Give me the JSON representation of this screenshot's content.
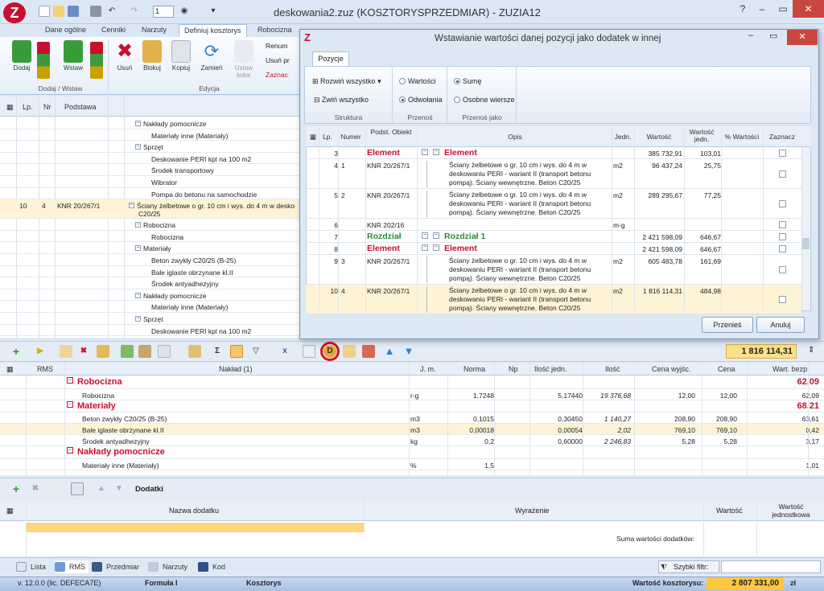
{
  "window": {
    "title": "deskowania2.zuz (KOSZTORYSPRZEDMIAR) - ZUZIA12",
    "logo": "Z",
    "quick_combo": "1"
  },
  "ribbon_tabs": [
    "Dane ogólne",
    "Cenniki",
    "Narzuty",
    "Definiuj kosztorys",
    "Robocizna"
  ],
  "ribbon": {
    "buttons": [
      "Dodaj",
      "Wstaw",
      "Usuń",
      "Blokuj",
      "Kopiuj",
      "Zamień",
      "Ustaw kolor"
    ],
    "small": [
      "Renum",
      "Usuń pr",
      "Zaznac"
    ],
    "groups": [
      "Dodaj / Wstaw",
      "Edycja"
    ]
  },
  "left_grid": {
    "headers": [
      "Lp.",
      "Nr",
      "Podstawa"
    ],
    "rows": [
      {
        "indent": 1,
        "box": "−",
        "text": "Nakłady pomocnicze"
      },
      {
        "indent": 2,
        "box": "",
        "text": "Materiały inne (Materiały)"
      },
      {
        "indent": 1,
        "box": "−",
        "text": "Sprzęt"
      },
      {
        "indent": 2,
        "box": "",
        "text": "Deskowanie PERI kpl na 100 m2"
      },
      {
        "indent": 2,
        "box": "",
        "text": "Środek transportowy"
      },
      {
        "indent": 2,
        "box": "",
        "text": "Wibrator"
      },
      {
        "indent": 2,
        "box": "",
        "text": "Pompa do betonu na samochodzie"
      },
      {
        "lp": "10",
        "nr": "4",
        "podstawa": "KNR 20/267/1",
        "indent": 0,
        "box": "−",
        "text": "Ściany żelbetowe o gr. 10 cm i wys. do 4 m w desko",
        "text2": "C20/25",
        "selected": true
      },
      {
        "indent": 1,
        "box": "−",
        "text": "Robocizna"
      },
      {
        "indent": 2,
        "box": "",
        "text": "Robocizna"
      },
      {
        "indent": 1,
        "box": "−",
        "text": "Materiały"
      },
      {
        "indent": 2,
        "box": "",
        "text": "Beton zwykły C20/25 (B-25)"
      },
      {
        "indent": 2,
        "box": "",
        "text": "Bale iglaste obrzynane kl.II"
      },
      {
        "indent": 2,
        "box": "",
        "text": "Środek antyadhezyjny"
      },
      {
        "indent": 1,
        "box": "−",
        "text": "Nakłady pomocnicze"
      },
      {
        "indent": 2,
        "box": "",
        "text": "Materiały inne (Materiały)"
      },
      {
        "indent": 1,
        "box": "−",
        "text": "Sprzęt"
      },
      {
        "indent": 2,
        "box": "",
        "text": "Deskowanie PERI kpl na 100 m2"
      }
    ]
  },
  "mid_toolbar": {
    "total": "1 816 114,31",
    "circled_icon": "dodatek-d-icon"
  },
  "rms": {
    "headers": [
      "RMS",
      "Nakład (1)",
      "J. m.",
      "Norma",
      "Np",
      "Ilość jedn.",
      "Ilość",
      "Cena wyjśc.",
      "Cena",
      "Wart. bezp."
    ],
    "rows": [
      {
        "section": true,
        "name": "Robocizna",
        "wart": "62,09"
      },
      {
        "name": "Robocizna",
        "jm": "r-g",
        "norma": "1,7248",
        "np": "",
        "ilj": "5,17440",
        "il": "19 376,68",
        "cw": "12,00",
        "cena": "12,00",
        "wart": "62,09"
      },
      {
        "section": true,
        "name": "Materiały",
        "wart": "68,21"
      },
      {
        "name": "Beton zwykły C20/25 (B-25)",
        "jm": "m3",
        "norma": "0,1015",
        "np": "",
        "ilj": "0,30450",
        "il": "1 140,27",
        "cw": "208,90",
        "cena": "208,90",
        "wart": "63,61"
      },
      {
        "name": "Bale iglaste obrzynane kl.II",
        "jm": "m3",
        "norma": "0,00018",
        "np": "",
        "ilj": "0,00054",
        "il": "2,02",
        "cw": "769,10",
        "cena": "769,10",
        "wart": "0,42",
        "selected": true
      },
      {
        "name": "Środek antyadhezyjny",
        "jm": "kg",
        "norma": "0,2",
        "np": "",
        "ilj": "0,60000",
        "il": "2 246,83",
        "cw": "5,28",
        "cena": "5,28",
        "wart": "3,17"
      },
      {
        "section": true,
        "name": "Nakłady pomocnicze",
        "wart": ""
      },
      {
        "name": "Materiały inne (Materiały)",
        "jm": "%",
        "norma": "1,5",
        "np": "",
        "ilj": "",
        "il": "",
        "cw": "",
        "cena": "",
        "wart": "1,01"
      }
    ]
  },
  "dodatki": {
    "title": "Dodatki",
    "headers": [
      "Nazwa dodatku",
      "Wyrażenie",
      "Wartość",
      "Wartość jednostkowa"
    ],
    "sum_label": "Suma wartości dodatków:"
  },
  "bottom_tabs": [
    "Lista",
    "RMS",
    "Przedmiar",
    "Narzuty",
    "Kod"
  ],
  "filter_label": "Szybki filtr:",
  "status": {
    "version": "v. 12.0.0 (lic. DEFECA7E)",
    "formula": "Formuła I",
    "kosztorys": "Kosztorys",
    "value_label": "Wartość kosztorysu:",
    "value": "2 807 331,00",
    "currency": "zł"
  },
  "dialog": {
    "title": "Wstawianie wartości danej pozycji jako dodatek w innej",
    "tab": "Pozycje",
    "struktura": {
      "label": "Struktura",
      "expand": "Rozwiń wszystko",
      "collapse": "Zwiń wszystko"
    },
    "przenos": {
      "label": "Przenoś",
      "opt1": "Wartości",
      "opt2": "Odwołania"
    },
    "przenos_jako": {
      "label": "Przenoś jako",
      "opt1": "Sumę",
      "opt2": "Osobne wiersze"
    },
    "headers": [
      "Lp.",
      "Numer",
      "Podst. Obiekt",
      "Opis",
      "Jedn.",
      "Wartość",
      "Wartość jedn.",
      "% Wartości",
      "Zaznacz"
    ],
    "rows": [
      {
        "lp": "3",
        "num": "",
        "podst": "Element",
        "opis": "Element",
        "jedn": "",
        "wart": "385 732,91",
        "wj": "103,01",
        "kind": "red",
        "lines": 1,
        "check": true
      },
      {
        "lp": "4",
        "num": "1",
        "podst": "KNR 20/267/1",
        "opis": [
          "Ściany żelbetowe o gr. 10 cm i wys. do 4 m w",
          "deskowaniu PERI - wariant II (transport betonu",
          "pompą). Ściany wewnętrzne. Beton C20/25"
        ],
        "jedn": "m2",
        "wart": "96 437,24",
        "wj": "25,75",
        "kind": "item",
        "lines": 3,
        "check": true
      },
      {
        "lp": "5",
        "num": "2",
        "podst": "KNR 20/267/1",
        "opis": [
          "Ściany żelbetowe o gr. 10 cm i wys. do 4 m w",
          "deskowaniu PERI - wariant II (transport betonu",
          "pompą). Ściany wewnętrzne. Beton C20/25"
        ],
        "jedn": "m2",
        "wart": "289 295,67",
        "wj": "77,25",
        "kind": "item",
        "lines": 3,
        "check": true
      },
      {
        "lp": "6",
        "num": "",
        "podst": "KNR 202/16",
        "opis": "",
        "jedn": "m-g",
        "wart": "",
        "wj": "",
        "kind": "item",
        "lines": 1,
        "check": false
      },
      {
        "lp": "7",
        "num": "",
        "podst": "Rozdział",
        "opis": "Rozdział 1",
        "jedn": "",
        "wart": "2 421 598,09",
        "wj": "646,67",
        "kind": "green",
        "lines": 1,
        "check": false
      },
      {
        "lp": "8",
        "num": "",
        "podst": "Element",
        "opis": "Element",
        "jedn": "",
        "wart": "2 421 598,09",
        "wj": "646,67",
        "kind": "red",
        "lines": 1,
        "check": false
      },
      {
        "lp": "9",
        "num": "3",
        "podst": "KNR 20/267/1",
        "opis": [
          "Ściany żelbetowe o gr. 10 cm i wys. do 4 m w",
          "deskowaniu PERI - wariant II (transport betonu",
          "pompą). Ściany wewnętrzne. Beton C20/25"
        ],
        "jedn": "m2",
        "wart": "605 483,78",
        "wj": "161,69",
        "kind": "item",
        "lines": 3,
        "check": true
      },
      {
        "lp": "10",
        "num": "4",
        "podst": "KNR 20/267/1",
        "opis": [
          "Ściany żelbetowe o gr. 10 cm i wys. do 4 m w",
          "deskowaniu PERI - wariant II (transport betonu",
          "pompą). Ściany wewnętrzne. Beton C20/25"
        ],
        "jedn": "m2",
        "wart": "1 816 114,31",
        "wj": "484,98",
        "kind": "item",
        "lines": 3,
        "check": true,
        "selected": true
      }
    ],
    "btn_ok": "Przenieś",
    "btn_cancel": "Anuluj"
  }
}
